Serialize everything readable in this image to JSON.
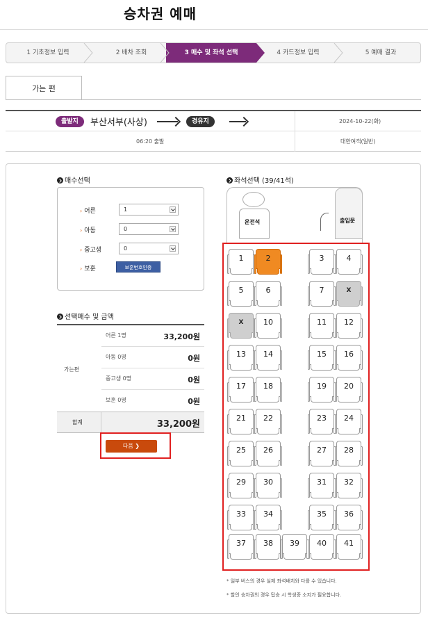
{
  "page": {
    "title": "승차권 예매"
  },
  "steps": [
    {
      "label": "1 기초정보 입력",
      "active": false
    },
    {
      "label": "2 배차 조회",
      "active": false
    },
    {
      "label": "3 매수 및 좌석 선택",
      "active": true
    },
    {
      "label": "4 카드정보 입력",
      "active": false
    },
    {
      "label": "5 예매 결과",
      "active": false
    }
  ],
  "tab": {
    "label": "가는 편"
  },
  "route": {
    "departure_badge": "출발지",
    "departure_name": "부산서부(사상)",
    "via_badge": "경유지",
    "date": "2024-10-22(화)",
    "departure_time": "06:20 출발",
    "company": "대한여객(일반)"
  },
  "passengers": {
    "title": "매수선택",
    "rows": [
      {
        "label": "어른",
        "value": "1"
      },
      {
        "label": "아동",
        "value": "0"
      },
      {
        "label": "중고생",
        "value": "0"
      }
    ],
    "veteran_label": "보훈",
    "veteran_button": "보훈번호인증"
  },
  "fare": {
    "title": "선택매수 및 금액",
    "group_label": "가는편",
    "rows": [
      {
        "label": "어른 1명",
        "value": "33,200원"
      },
      {
        "label": "아동 0명",
        "value": "0원"
      },
      {
        "label": "중고생 0명",
        "value": "0원"
      },
      {
        "label": "보훈 0명",
        "value": "0원"
      }
    ],
    "total_label": "합계",
    "total_value": "33,200원"
  },
  "next_button": "다음 ❯",
  "seat_selection": {
    "title": "좌석선택 (39/41석)",
    "driver_label": "운전석",
    "door_label": "출입문",
    "taken_mark": "X",
    "selected_seats": [
      "2"
    ],
    "taken_seats": [
      "8",
      "9"
    ],
    "seats": [
      "1",
      "2",
      "3",
      "4",
      "5",
      "6",
      "7",
      "8",
      "9",
      "10",
      "11",
      "12",
      "13",
      "14",
      "15",
      "16",
      "17",
      "18",
      "19",
      "20",
      "21",
      "22",
      "23",
      "24",
      "25",
      "26",
      "27",
      "28",
      "29",
      "30",
      "31",
      "32",
      "33",
      "34",
      "35",
      "36",
      "37",
      "38",
      "39",
      "40",
      "41"
    ]
  },
  "notes": [
    "* 일부 버스의 경우 실제 좌석배치와 다를 수 있습니다.",
    "* 할인 승차권의 경우 탑승 시 학생증 소지가 필요합니다."
  ]
}
